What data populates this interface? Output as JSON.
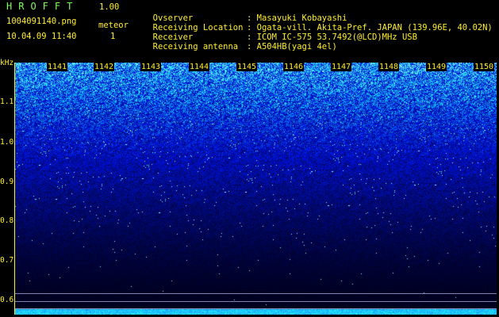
{
  "header": {
    "title": "HROFFT",
    "version": "1.00",
    "filename": "1004091140.png",
    "meteor_label": "meteor",
    "datetime": "10.04.09 11:40",
    "meteor_count": "1",
    "info": [
      {
        "label": "Ovserver",
        "value": "Masayuki Kobayashi"
      },
      {
        "label": "Receiving Location",
        "value": "Ogata-vill. Akita-Pref. JAPAN (139.96E, 40.02N)"
      },
      {
        "label": "Receiver",
        "value": "ICOM IC-575 53.7492(@LCD)MHz USB"
      },
      {
        "label": "Receiving antenna",
        "value": "A504HB(yagi 4el)"
      }
    ]
  },
  "axis": {
    "unit": "kHz",
    "labels": [
      "1.1",
      "1.0",
      "0.9",
      "0.8",
      "0.7",
      "0.6"
    ]
  },
  "time_marks": [
    "1141",
    "1142",
    "1143",
    "1144",
    "1145",
    "1146",
    "1147",
    "1148",
    "1149",
    "1150"
  ],
  "colors": {
    "header_green": "#7cff5a",
    "header_yellow": "#ffee2e",
    "spectrum_low": "#000020",
    "spectrum_high": "#20c8ff"
  }
}
